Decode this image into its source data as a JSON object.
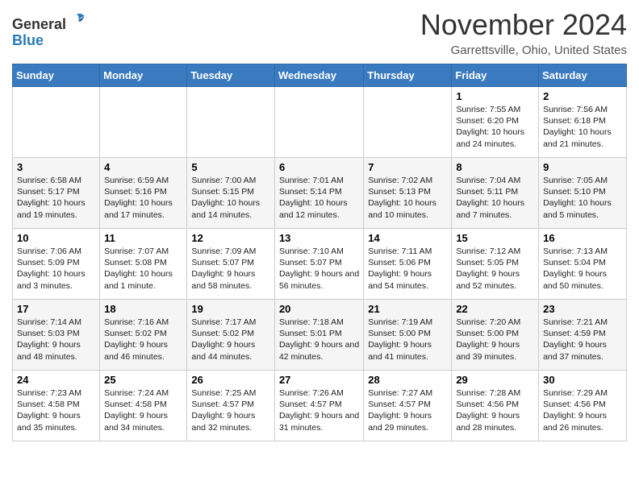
{
  "header": {
    "logo": {
      "line1": "General",
      "line2": "Blue"
    },
    "title": "November 2024",
    "location": "Garrettsville, Ohio, United States"
  },
  "calendar": {
    "days_of_week": [
      "Sunday",
      "Monday",
      "Tuesday",
      "Wednesday",
      "Thursday",
      "Friday",
      "Saturday"
    ],
    "weeks": [
      [
        {
          "day": "",
          "info": ""
        },
        {
          "day": "",
          "info": ""
        },
        {
          "day": "",
          "info": ""
        },
        {
          "day": "",
          "info": ""
        },
        {
          "day": "",
          "info": ""
        },
        {
          "day": "1",
          "info": "Sunrise: 7:55 AM\nSunset: 6:20 PM\nDaylight: 10 hours and 24 minutes."
        },
        {
          "day": "2",
          "info": "Sunrise: 7:56 AM\nSunset: 6:18 PM\nDaylight: 10 hours and 21 minutes."
        }
      ],
      [
        {
          "day": "3",
          "info": "Sunrise: 6:58 AM\nSunset: 5:17 PM\nDaylight: 10 hours and 19 minutes."
        },
        {
          "day": "4",
          "info": "Sunrise: 6:59 AM\nSunset: 5:16 PM\nDaylight: 10 hours and 17 minutes."
        },
        {
          "day": "5",
          "info": "Sunrise: 7:00 AM\nSunset: 5:15 PM\nDaylight: 10 hours and 14 minutes."
        },
        {
          "day": "6",
          "info": "Sunrise: 7:01 AM\nSunset: 5:14 PM\nDaylight: 10 hours and 12 minutes."
        },
        {
          "day": "7",
          "info": "Sunrise: 7:02 AM\nSunset: 5:13 PM\nDaylight: 10 hours and 10 minutes."
        },
        {
          "day": "8",
          "info": "Sunrise: 7:04 AM\nSunset: 5:11 PM\nDaylight: 10 hours and 7 minutes."
        },
        {
          "day": "9",
          "info": "Sunrise: 7:05 AM\nSunset: 5:10 PM\nDaylight: 10 hours and 5 minutes."
        }
      ],
      [
        {
          "day": "10",
          "info": "Sunrise: 7:06 AM\nSunset: 5:09 PM\nDaylight: 10 hours and 3 minutes."
        },
        {
          "day": "11",
          "info": "Sunrise: 7:07 AM\nSunset: 5:08 PM\nDaylight: 10 hours and 1 minute."
        },
        {
          "day": "12",
          "info": "Sunrise: 7:09 AM\nSunset: 5:07 PM\nDaylight: 9 hours and 58 minutes."
        },
        {
          "day": "13",
          "info": "Sunrise: 7:10 AM\nSunset: 5:07 PM\nDaylight: 9 hours and 56 minutes."
        },
        {
          "day": "14",
          "info": "Sunrise: 7:11 AM\nSunset: 5:06 PM\nDaylight: 9 hours and 54 minutes."
        },
        {
          "day": "15",
          "info": "Sunrise: 7:12 AM\nSunset: 5:05 PM\nDaylight: 9 hours and 52 minutes."
        },
        {
          "day": "16",
          "info": "Sunrise: 7:13 AM\nSunset: 5:04 PM\nDaylight: 9 hours and 50 minutes."
        }
      ],
      [
        {
          "day": "17",
          "info": "Sunrise: 7:14 AM\nSunset: 5:03 PM\nDaylight: 9 hours and 48 minutes."
        },
        {
          "day": "18",
          "info": "Sunrise: 7:16 AM\nSunset: 5:02 PM\nDaylight: 9 hours and 46 minutes."
        },
        {
          "day": "19",
          "info": "Sunrise: 7:17 AM\nSunset: 5:02 PM\nDaylight: 9 hours and 44 minutes."
        },
        {
          "day": "20",
          "info": "Sunrise: 7:18 AM\nSunset: 5:01 PM\nDaylight: 9 hours and 42 minutes."
        },
        {
          "day": "21",
          "info": "Sunrise: 7:19 AM\nSunset: 5:00 PM\nDaylight: 9 hours and 41 minutes."
        },
        {
          "day": "22",
          "info": "Sunrise: 7:20 AM\nSunset: 5:00 PM\nDaylight: 9 hours and 39 minutes."
        },
        {
          "day": "23",
          "info": "Sunrise: 7:21 AM\nSunset: 4:59 PM\nDaylight: 9 hours and 37 minutes."
        }
      ],
      [
        {
          "day": "24",
          "info": "Sunrise: 7:23 AM\nSunset: 4:58 PM\nDaylight: 9 hours and 35 minutes."
        },
        {
          "day": "25",
          "info": "Sunrise: 7:24 AM\nSunset: 4:58 PM\nDaylight: 9 hours and 34 minutes."
        },
        {
          "day": "26",
          "info": "Sunrise: 7:25 AM\nSunset: 4:57 PM\nDaylight: 9 hours and 32 minutes."
        },
        {
          "day": "27",
          "info": "Sunrise: 7:26 AM\nSunset: 4:57 PM\nDaylight: 9 hours and 31 minutes."
        },
        {
          "day": "28",
          "info": "Sunrise: 7:27 AM\nSunset: 4:57 PM\nDaylight: 9 hours and 29 minutes."
        },
        {
          "day": "29",
          "info": "Sunrise: 7:28 AM\nSunset: 4:56 PM\nDaylight: 9 hours and 28 minutes."
        },
        {
          "day": "30",
          "info": "Sunrise: 7:29 AM\nSunset: 4:56 PM\nDaylight: 9 hours and 26 minutes."
        }
      ]
    ]
  }
}
